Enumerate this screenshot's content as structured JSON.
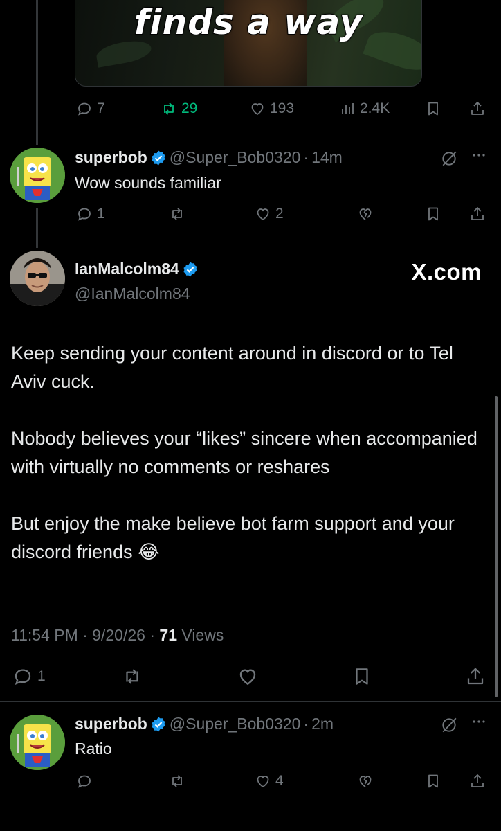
{
  "top_tweet": {
    "media_caption": "finds a way",
    "stats": {
      "replies": "7",
      "reposts": "29",
      "likes": "193",
      "views": "2.4K"
    }
  },
  "reply1": {
    "name": "superbob",
    "handle": "@Super_Bob0320",
    "time": "14m",
    "text": "Wow sounds familiar",
    "stats": {
      "replies": "1",
      "likes": "2"
    }
  },
  "main_post": {
    "name": "IanMalcolm84",
    "handle": "@IanMalcolm84",
    "source": "X.com",
    "paragraphs": [
      "Keep sending your content around in discord or to Tel Aviv cuck.",
      "Nobody believes your “likes” sincere when accompanied with virtually no comments or reshares",
      "But enjoy the make believe bot farm support and your discord friends"
    ],
    "emoji": "😂",
    "time": "11:54 PM",
    "date": "9/20/26",
    "views_count": "71",
    "views_label": "Views",
    "stats": {
      "replies": "1"
    }
  },
  "reply2": {
    "name": "superbob",
    "handle": "@Super_Bob0320",
    "time": "2m",
    "text": "Ratio",
    "stats": {
      "likes": "4"
    }
  },
  "separator": "·",
  "theme": {
    "background": "#000000",
    "text": "#e7e9ea",
    "muted": "#71767b",
    "verified": "#1d9bf0",
    "repost_active": "#00ba7c"
  }
}
